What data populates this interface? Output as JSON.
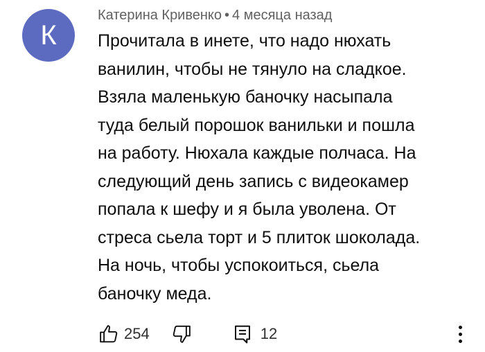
{
  "comment": {
    "avatar_letter": "К",
    "avatar_color": "#5c6bc0",
    "author": "Катерина Кривенко",
    "separator": "•",
    "time": "4 месяца назад",
    "text": "Прочитала в инете, что надо нюхать\nванилин, чтобы не тянуло на сладкое.\nВзяла  маленькую баночку насыпала\nтуда белый порошок ванильки и пошла\nна работу. Нюхала каждые полчаса. На\nследующий день запись с видеокамер\nпопала к шефу и я была уволена. От\nстреса сьела торт и 5 плиток шоколада.\nНа ночь, чтобы успокоиться, сьела\nбаночку меда."
  },
  "actions": {
    "like_icon": "thumbs-up-icon",
    "like_count": "254",
    "dislike_icon": "thumbs-down-icon",
    "reply_icon": "reply-comment-icon",
    "reply_count": "12",
    "more_icon": "more-vertical-icon"
  }
}
